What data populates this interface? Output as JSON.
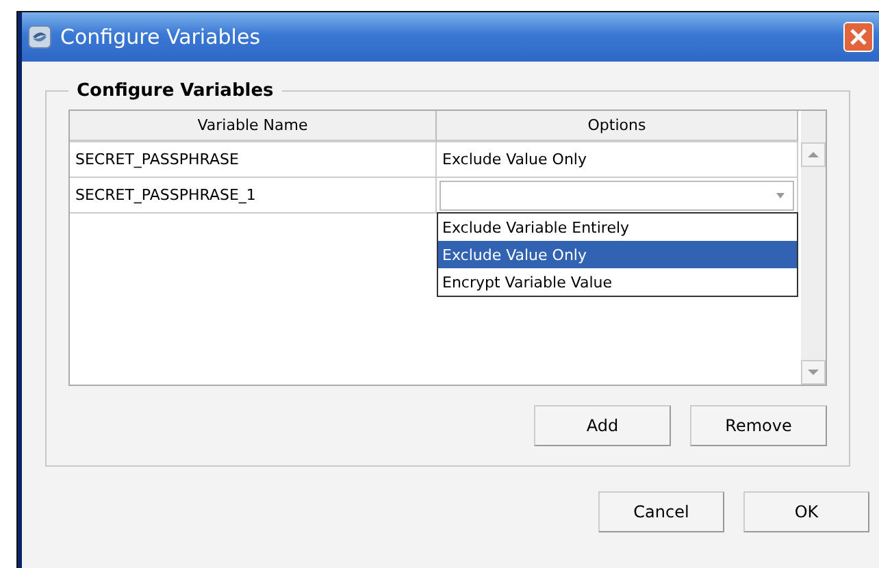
{
  "window": {
    "title": "Configure Variables"
  },
  "group": {
    "title": "Configure Variables"
  },
  "table": {
    "columns": [
      "Variable Name",
      "Options"
    ],
    "rows": [
      {
        "name": "SECRET_PASSPHRASE",
        "option": "Exclude Value Only",
        "editing": false
      },
      {
        "name": "SECRET_PASSPHRASE_1",
        "option": "",
        "editing": true
      }
    ]
  },
  "dropdown": {
    "items": [
      {
        "label": "Exclude Variable Entirely",
        "selected": false
      },
      {
        "label": "Exclude Value Only",
        "selected": true
      },
      {
        "label": "Encrypt Variable Value",
        "selected": false
      }
    ]
  },
  "table_buttons": [
    "Add",
    "Remove"
  ],
  "dialog_buttons": [
    "Cancel",
    "OK"
  ]
}
